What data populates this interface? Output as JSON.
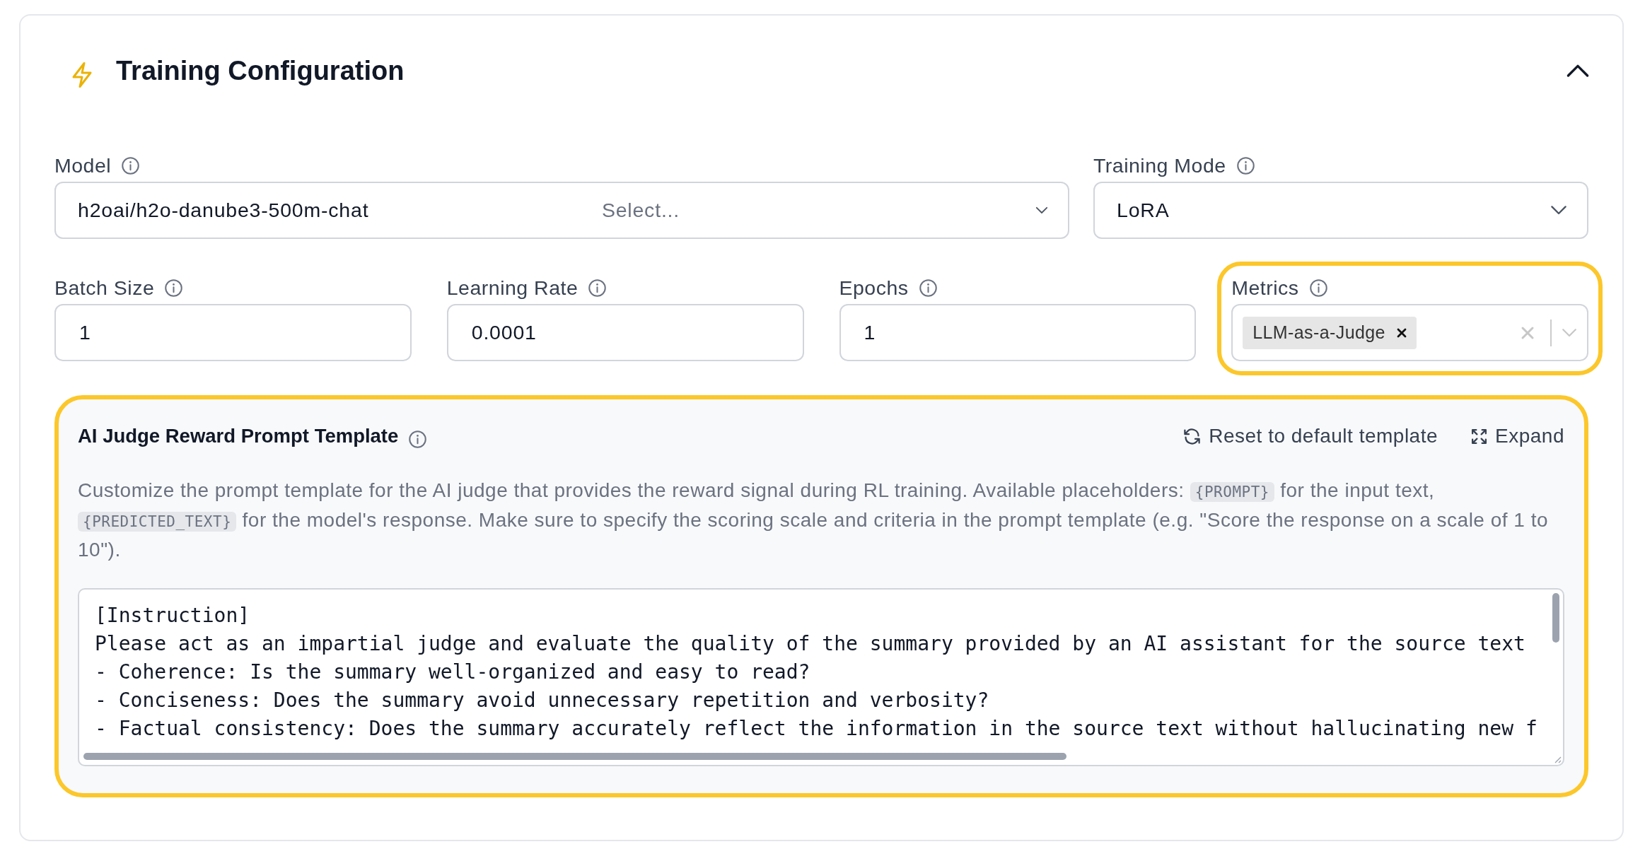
{
  "header": {
    "title": "Training Configuration",
    "expanded": true
  },
  "fields": [
    {
      "kind": "select",
      "label": "Model",
      "value": "h2oai/h2o-danube3-500m-chat",
      "placeholder": "Select...",
      "highlighted": false
    },
    {
      "kind": "select",
      "label": "Training Mode",
      "value": "LoRA",
      "highlighted": false
    },
    {
      "kind": "input",
      "label": "Batch Size",
      "value": "1",
      "highlighted": false
    },
    {
      "kind": "input",
      "label": "Learning Rate",
      "value": "0.0001",
      "highlighted": false
    },
    {
      "kind": "input",
      "label": "Epochs",
      "value": "1",
      "highlighted": false
    },
    {
      "kind": "multiselect",
      "label": "Metrics",
      "tags": [
        "LLM-as-a-Judge"
      ],
      "highlighted": true
    }
  ],
  "template_panel": {
    "title": "AI Judge Reward Prompt Template",
    "highlighted": true,
    "actions": [
      {
        "kind": "reset",
        "label": "Reset to default template"
      },
      {
        "kind": "expand",
        "label": "Expand"
      }
    ],
    "description": [
      {
        "kind": "text",
        "text": "Customize the prompt template for the AI judge that provides the reward signal during RL training. Available placeholders: "
      },
      {
        "kind": "code",
        "text": "{PROMPT}"
      },
      {
        "kind": "text",
        "text": " for the input text, "
      },
      {
        "kind": "code",
        "text": "{PREDICTED_TEXT}"
      },
      {
        "kind": "text",
        "text": " for the model's response. Make sure to specify the scoring scale and criteria in the prompt template (e.g. \"Score the response on a scale of 1 to 10\")."
      }
    ],
    "template_lines": [
      "[Instruction]",
      "Please act as an impartial judge and evaluate the quality of the summary provided by an AI assistant for the source text",
      "- Coherence: Is the summary well-organized and easy to read?",
      "- Conciseness: Does the summary avoid unnecessary repetition and verbosity?",
      "- Factual consistency: Does the summary accurately reflect the information in the source text without hallucinating new f"
    ]
  }
}
